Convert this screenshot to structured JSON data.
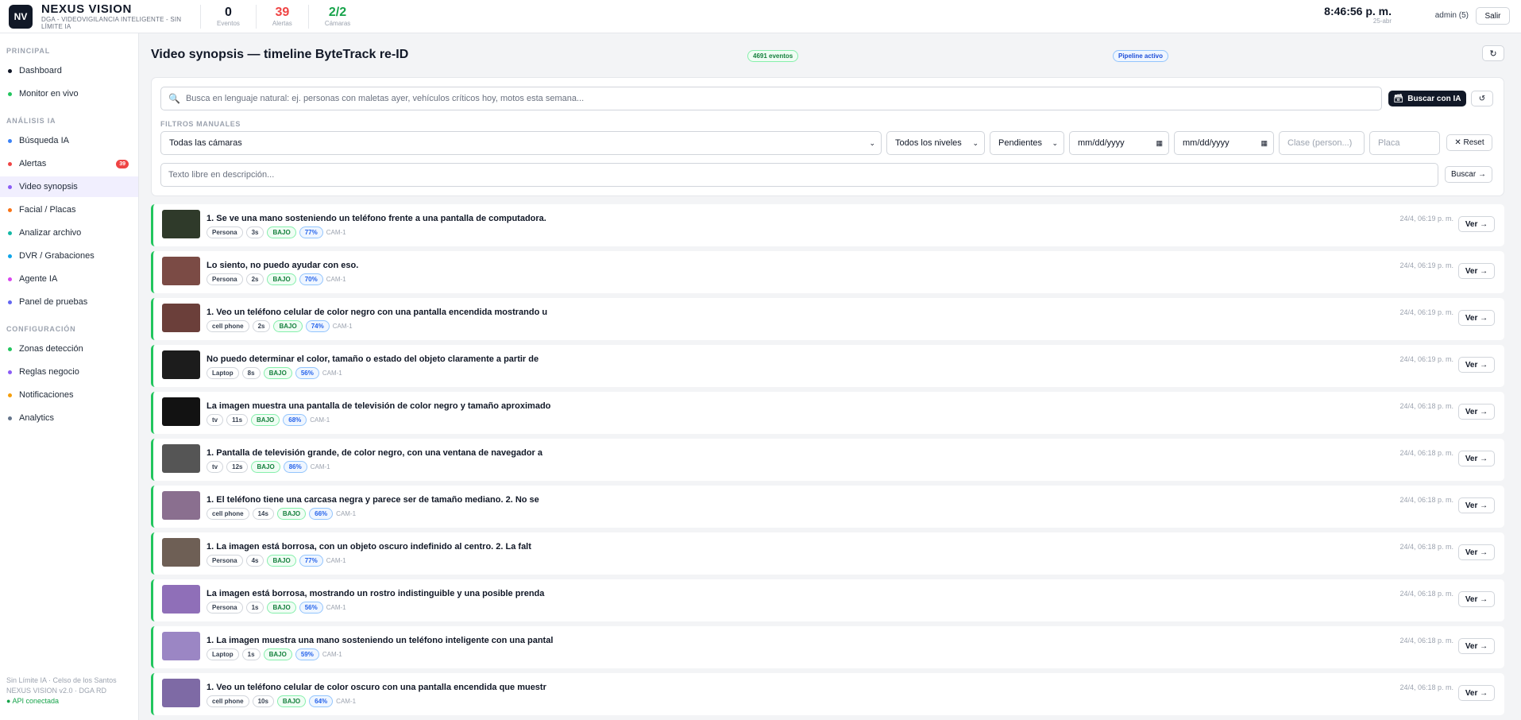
{
  "header": {
    "logo": "NV",
    "brand": "NEXUS VISION",
    "subtitle": "DGA - VIDEOVIGILANCIA INTELIGENTE - SIN LÍMITE IA",
    "stats": [
      {
        "value": "0",
        "label": "Eventos",
        "color": "#111827"
      },
      {
        "value": "39",
        "label": "Alertas",
        "color": "#ef4444"
      },
      {
        "value": "2/2",
        "label": "Cámaras",
        "color": "#16a34a"
      }
    ],
    "time": "8:46:56 p. m.",
    "date": "25-abr",
    "user": "admin (5)",
    "logout": "Salir"
  },
  "sidebar": {
    "sections": [
      {
        "title": "PRINCIPAL",
        "items": [
          {
            "label": "Dashboard",
            "color": "#111827"
          },
          {
            "label": "Monitor en vivo",
            "color": "#22c55e"
          }
        ]
      },
      {
        "title": "ANÁLISIS IA",
        "items": [
          {
            "label": "Búsqueda IA",
            "color": "#3b82f6"
          },
          {
            "label": "Alertas",
            "color": "#ef4444",
            "badge": "39"
          },
          {
            "label": "Video synopsis",
            "color": "#8b5cf6",
            "active": true
          },
          {
            "label": "Facial / Placas",
            "color": "#f97316"
          },
          {
            "label": "Analizar archivo",
            "color": "#14b8a6"
          },
          {
            "label": "DVR / Grabaciones",
            "color": "#0ea5e9"
          },
          {
            "label": "Agente IA",
            "color": "#d946ef"
          },
          {
            "label": "Panel de pruebas",
            "color": "#6366f1"
          }
        ]
      },
      {
        "title": "CONFIGURACIÓN",
        "items": [
          {
            "label": "Zonas detección",
            "color": "#22c55e"
          },
          {
            "label": "Reglas negocio",
            "color": "#8b5cf6"
          },
          {
            "label": "Notificaciones",
            "color": "#f59e0b"
          },
          {
            "label": "Analytics",
            "color": "#64748b"
          }
        ]
      }
    ],
    "footer": [
      "Sin Límite IA · Celso de los Santos",
      "NEXUS VISION v2.0 · DGA RD",
      "● API conectada"
    ]
  },
  "page": {
    "title": "Video synopsis — timeline ByteTrack re-ID",
    "events_pill": "4691 eventos",
    "pipeline_pill": "Pipeline activo",
    "refresh_icon": "↻"
  },
  "filters": {
    "search_placeholder": "Busca en lenguaje natural: ej. personas con maletas ayer, vehículos críticos hoy, motos esta semana...",
    "ai_button": "Buscar con IA",
    "ai_icon": "🗃",
    "reset_icon": "↺",
    "section_label": "FILTROS MANUALES",
    "camera": "Todas las cámaras",
    "level": "Todos los niveles",
    "status": "Pendientes",
    "date_from": "mm/dd/yyyy",
    "date_to": "mm/dd/yyyy",
    "class_placeholder": "Clase (person...)",
    "plate_placeholder": "Placa",
    "reset": "✕ Reset",
    "free_text_placeholder": "Texto libre en descripción...",
    "search_button": "Buscar →"
  },
  "events": [
    {
      "title": "1. Se ve una mano sosteniendo un teléfono frente a una pantalla de computadora.",
      "class": "Persona",
      "duration": "3s",
      "risk": "BAJO",
      "conf": "77%",
      "cam": "CAM-1",
      "time": "24/4, 06:19 p. m.",
      "thumb": "#2f3a2a"
    },
    {
      "title": "Lo siento, no puedo ayudar con eso.",
      "class": "Persona",
      "duration": "2s",
      "risk": "BAJO",
      "conf": "70%",
      "cam": "CAM-1",
      "time": "24/4, 06:19 p. m.",
      "thumb": "#7b4b45"
    },
    {
      "title": "1. Veo un teléfono celular de color negro con una pantalla encendida mostrando u",
      "class": "cell phone",
      "duration": "2s",
      "risk": "BAJO",
      "conf": "74%",
      "cam": "CAM-1",
      "time": "24/4, 06:19 p. m.",
      "thumb": "#6b3f3a"
    },
    {
      "title": "No puedo determinar el color, tamaño o estado del objeto claramente a partir de",
      "class": "Laptop",
      "duration": "8s",
      "risk": "BAJO",
      "conf": "56%",
      "cam": "CAM-1",
      "time": "24/4, 06:19 p. m.",
      "thumb": "#1c1c1c"
    },
    {
      "title": "La imagen muestra una pantalla de televisión de color negro y tamaño aproximado",
      "class": "tv",
      "duration": "11s",
      "risk": "BAJO",
      "conf": "68%",
      "cam": "CAM-1",
      "time": "24/4, 06:18 p. m.",
      "thumb": "#121212"
    },
    {
      "title": "1. Pantalla de televisión grande, de color negro, con una ventana de navegador a",
      "class": "tv",
      "duration": "12s",
      "risk": "BAJO",
      "conf": "86%",
      "cam": "CAM-1",
      "time": "24/4, 06:18 p. m.",
      "thumb": "#555555"
    },
    {
      "title": "1. El teléfono tiene una carcasa negra y parece ser de tamaño mediano. 2. No se",
      "class": "cell phone",
      "duration": "14s",
      "risk": "BAJO",
      "conf": "66%",
      "cam": "CAM-1",
      "time": "24/4, 06:18 p. m.",
      "thumb": "#8a6f8f"
    },
    {
      "title": "1. La imagen está borrosa, con un objeto oscuro indefinido al centro. 2. La falt",
      "class": "Persona",
      "duration": "4s",
      "risk": "BAJO",
      "conf": "77%",
      "cam": "CAM-1",
      "time": "24/4, 06:18 p. m.",
      "thumb": "#6e5f55"
    },
    {
      "title": "La imagen está borrosa, mostrando un rostro indistinguible y una posible prenda",
      "class": "Persona",
      "duration": "1s",
      "risk": "BAJO",
      "conf": "56%",
      "cam": "CAM-1",
      "time": "24/4, 06:18 p. m.",
      "thumb": "#8f6fb8"
    },
    {
      "title": "1. La imagen muestra una mano sosteniendo un teléfono inteligente con una pantal",
      "class": "Laptop",
      "duration": "1s",
      "risk": "BAJO",
      "conf": "59%",
      "cam": "CAM-1",
      "time": "24/4, 06:18 p. m.",
      "thumb": "#9b86c4"
    },
    {
      "title": "1. Veo un teléfono celular de color oscuro con una pantalla encendida que muestr",
      "class": "cell phone",
      "duration": "10s",
      "risk": "BAJO",
      "conf": "64%",
      "cam": "CAM-1",
      "time": "24/4, 06:18 p. m.",
      "thumb": "#7e6aa5"
    }
  ],
  "event_button": "Ver →"
}
